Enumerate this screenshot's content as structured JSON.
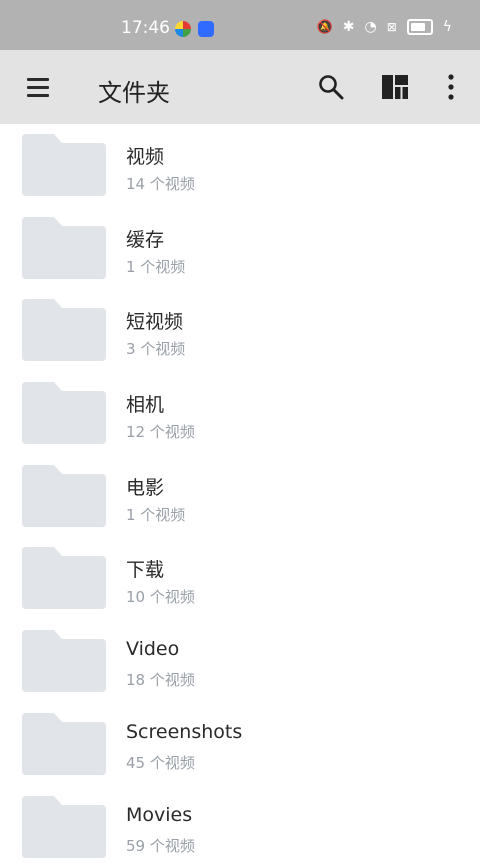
{
  "status_bar": {
    "time": "17:46"
  },
  "app_bar": {
    "title": "文件夹"
  },
  "folders": [
    {
      "name": "视频",
      "count": "14 个视频"
    },
    {
      "name": "缓存",
      "count": "1 个视频"
    },
    {
      "name": "短视频",
      "count": "3 个视频"
    },
    {
      "name": "相机",
      "count": "12 个视频"
    },
    {
      "name": "电影",
      "count": "1 个视频"
    },
    {
      "name": "下载",
      "count": "10 个视频"
    },
    {
      "name": "Video",
      "count": "18 个视频"
    },
    {
      "name": "Screenshots",
      "count": "45 个视频"
    },
    {
      "name": "Movies",
      "count": "59 个视频"
    }
  ],
  "colors": {
    "status_bar_bg": "#b2b2b2",
    "app_bar_bg": "#e3e3e3",
    "folder_icon": "#e1e4e8",
    "title_text": "#222222",
    "secondary_text": "#9aa0a8"
  },
  "icons": [
    "menu-icon",
    "search-icon",
    "view-layout-icon",
    "more-vert-icon",
    "folder-icon"
  ]
}
